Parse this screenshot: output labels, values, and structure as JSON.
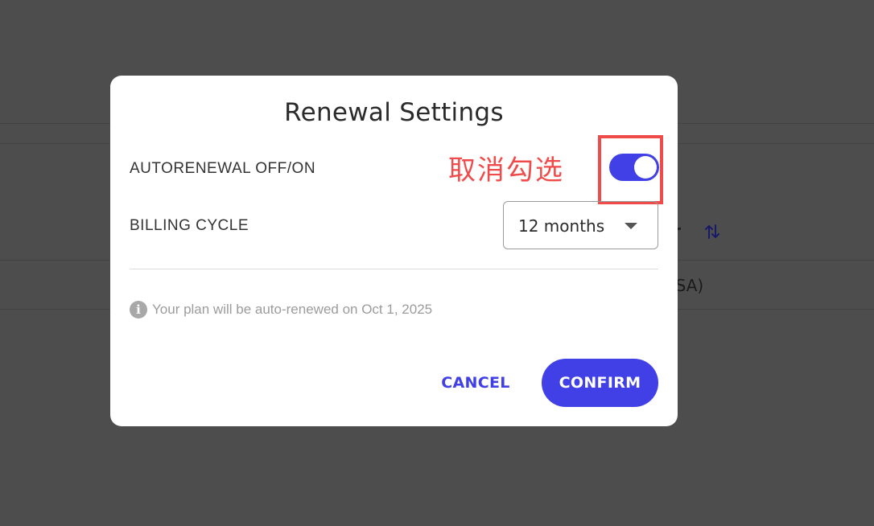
{
  "background": {
    "table_header_fragment": "r",
    "table_cell_fragment": "USA)",
    "sort_icon": "sort-arrows-icon"
  },
  "dialog": {
    "title": "Renewal Settings",
    "autorenewal": {
      "label": "AUTORENEWAL OFF/ON",
      "enabled": true
    },
    "billing_cycle": {
      "label": "BILLING CYCLE",
      "selected": "12 months"
    },
    "info": {
      "icon": "info-icon",
      "glyph": "i",
      "text": "Your plan will be auto-renewed on Oct 1, 2025"
    },
    "buttons": {
      "cancel_label": "CANCEL",
      "confirm_label": "CONFIRM"
    }
  },
  "annotation": {
    "text": "取消勾选",
    "color": "#f04b4b"
  },
  "colors": {
    "accent": "#4040e6",
    "overlay": "#4d4d4d"
  }
}
